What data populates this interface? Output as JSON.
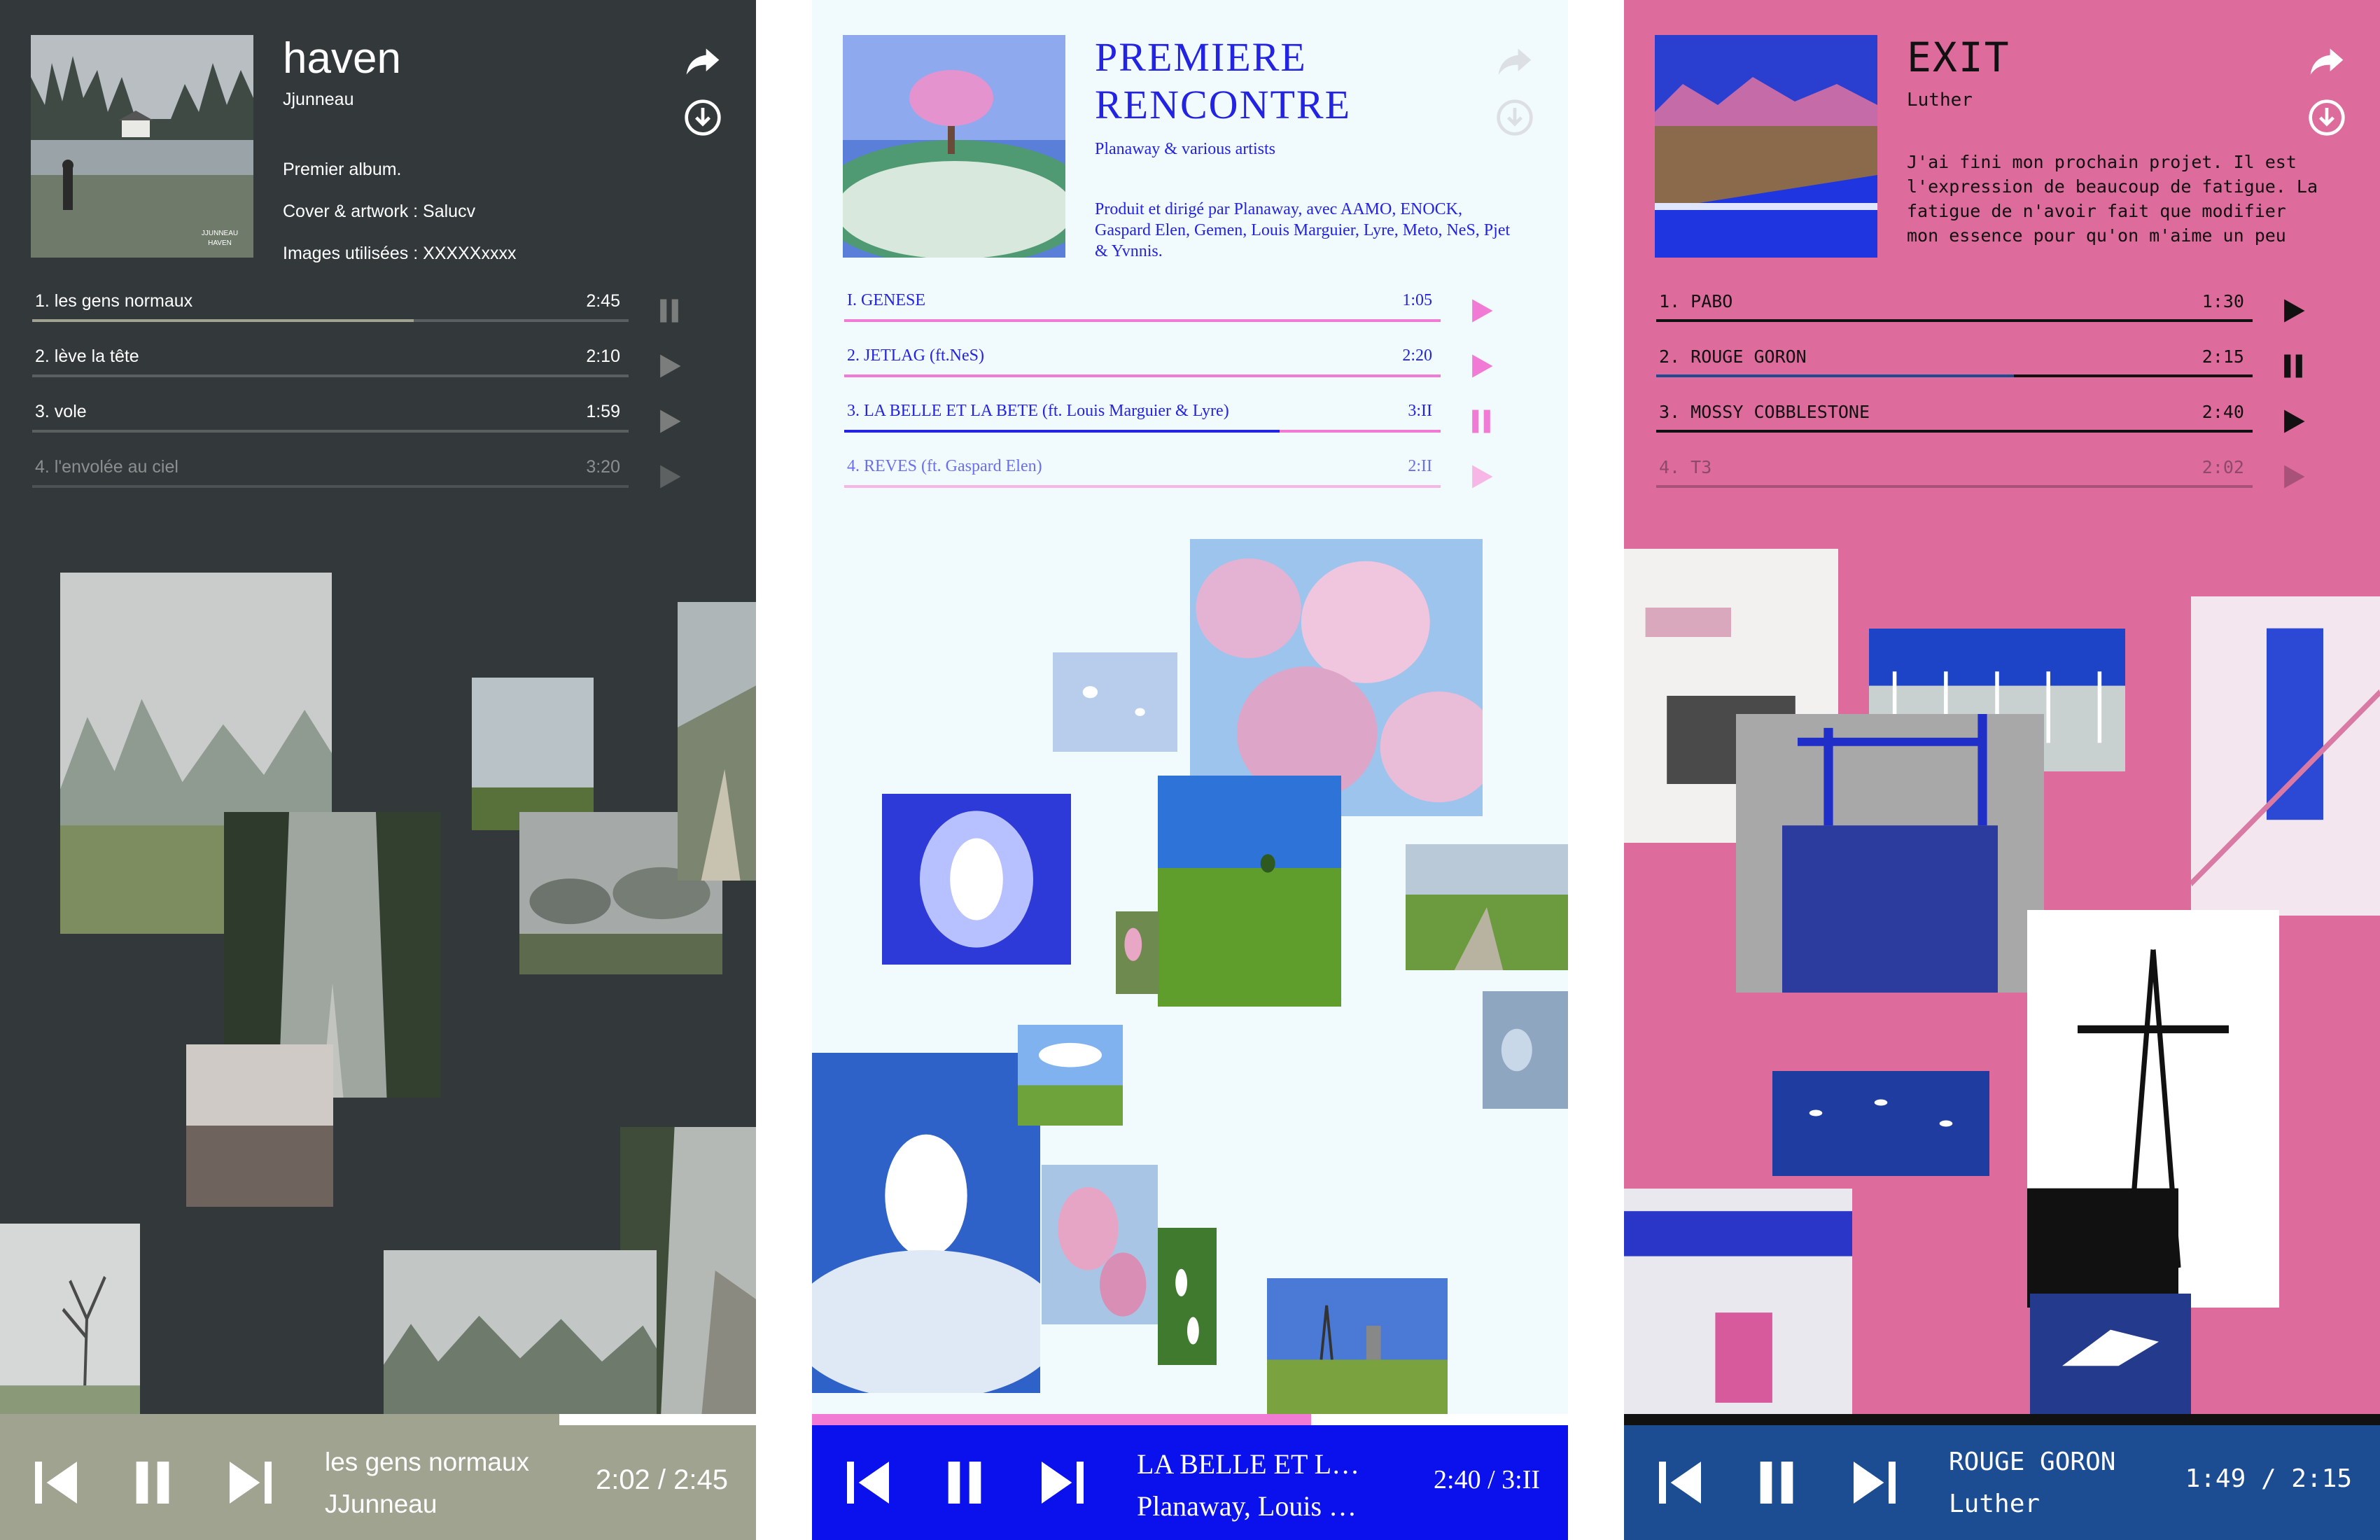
{
  "albums": [
    {
      "title": "haven",
      "artist": "Jjunneau",
      "description": [
        "Premier album.",
        "Cover & artwork : Salucv",
        "Images utilisées : XXXXXxxxx"
      ],
      "cover_text": "HAVEN",
      "tracks": [
        {
          "name": "1. les gens normaux",
          "duration": "2:45",
          "progress": 0.64,
          "state": "playing"
        },
        {
          "name": "2. lève la tête",
          "duration": "2:10",
          "progress": 0,
          "state": "paused"
        },
        {
          "name": "3. vole",
          "duration": "1:59",
          "progress": 0,
          "state": "paused"
        },
        {
          "name": "4. l'envolée au ciel",
          "duration": "3:20",
          "progress": 0,
          "state": "disabled"
        }
      ],
      "now_playing": {
        "title": "les gens normaux",
        "artist": "JJunneau",
        "time": "2:02 / 2:45",
        "progress": 0.74
      },
      "colors": {
        "background": "#33383a",
        "text": "#ffffff",
        "accent": "#a1a391",
        "player": "#a1a391"
      }
    },
    {
      "title": "PREMIERE RENCONTRE",
      "artist": "Planaway & various artists",
      "description": "Produit et dirigé par Planaway, avec AAMO, ENOCK, Gaspard Elen, Gemen, Louis Marguier, Lyre, Meto, NeS, Pjet & Yvnnis.",
      "tracks": [
        {
          "name": "I. GENESE",
          "duration": "1:05",
          "progress": 0,
          "state": "paused"
        },
        {
          "name": "2. JETLAG (ft.NeS)",
          "duration": "2:20",
          "progress": 0,
          "state": "paused"
        },
        {
          "name": "3. LA BELLE ET LA BETE (ft. Louis Marguier & Lyre)",
          "duration": "3:II",
          "progress": 0.73,
          "state": "playing"
        },
        {
          "name": "4. REVES (ft. Gaspard Elen)",
          "duration": "2:II",
          "progress": 0,
          "state": "disabled"
        }
      ],
      "now_playing": {
        "title": "LA BELLE ET LA BETE",
        "artist": "Planaway, Louis Marguier & Lyre",
        "time": "2:40 / 3:II",
        "progress": 0.66
      },
      "colors": {
        "background": "#f1fafd",
        "text": "#2323e4",
        "accent": "#f17bd4",
        "player": "#0a11ec"
      }
    },
    {
      "title": "EXIT",
      "artist": "Luther",
      "description": "J'ai fini mon prochain projet. Il est l'expression de beaucoup de fatigue. La fatigue de n'avoir fait que modifier mon essence pour qu'on m'aime un peu plus. Je",
      "tracks": [
        {
          "name": "1. PABO",
          "duration": "1:30",
          "progress": 0,
          "state": "paused"
        },
        {
          "name": "2. ROUGE GORON",
          "duration": "2:15",
          "progress": 0.6,
          "state": "playing"
        },
        {
          "name": "3. MOSSY COBBLESTONE",
          "duration": "2:40",
          "progress": 0,
          "state": "paused"
        },
        {
          "name": "4. T3",
          "duration": "2:02",
          "progress": 0,
          "state": "disabled"
        }
      ],
      "now_playing": {
        "title": "ROUGE GORON",
        "artist": "Luther",
        "time": "1:49 / 2:15",
        "progress": 0.79
      },
      "colors": {
        "background": "#dd6b9c",
        "text": "#111111",
        "accent": "#1c4d93",
        "player": "#1c4d93"
      }
    }
  ],
  "icons": [
    "share-icon",
    "download-icon",
    "play-icon",
    "pause-icon",
    "skip-previous-icon",
    "skip-next-icon"
  ]
}
